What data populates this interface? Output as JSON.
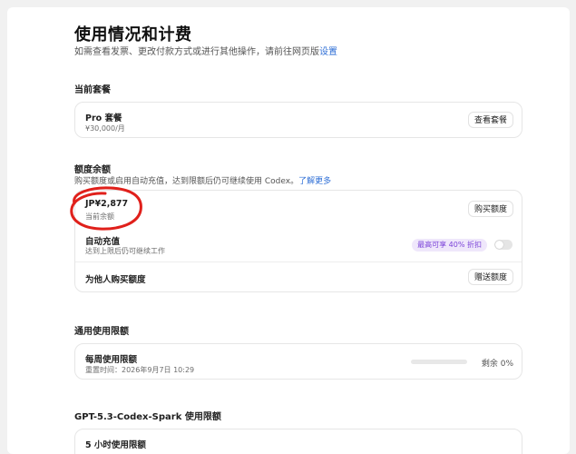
{
  "header": {
    "title": "使用情况和计费",
    "subtitle": "如需查看发票、更改付款方式或进行其他操作，请前往网页版",
    "subtitle_link": "设置"
  },
  "plan": {
    "section_title": "当前套餐",
    "name": "Pro 套餐",
    "price": "¥30,000/月",
    "button": "查看套餐"
  },
  "credits": {
    "section_title": "额度余额",
    "description": "购买额度或启用自动充值，达到限额后仍可继续使用 Codex。",
    "learn_more": "了解更多",
    "balance": "JP¥2,877",
    "balance_label": "当前余额",
    "buy_button": "购买额度",
    "auto_recharge_title": "自动充值",
    "auto_recharge_desc": "达到上限后仍可继续工作",
    "promo_badge": "最高可享 40% 折扣",
    "auto_recharge_enabled": false,
    "gift_title": "为他人购买额度",
    "gift_button": "赠送额度"
  },
  "general_limits": {
    "section_title": "通用使用限额",
    "weekly_title": "每周使用限额",
    "reset_time": "重置时间：2026年9月7日 10:29",
    "remaining_text": "剩余 0%",
    "remaining_fraction": 0
  },
  "spark_limits": {
    "section_title": "GPT-5.3-Codex-Spark 使用限额",
    "row_title": "5 小时使用限额"
  },
  "colors": {
    "accent_link": "#2f6fd6",
    "promo_bg": "#efe7fb",
    "promo_text": "#7b43d8",
    "annotation_red": "#e0201b"
  }
}
